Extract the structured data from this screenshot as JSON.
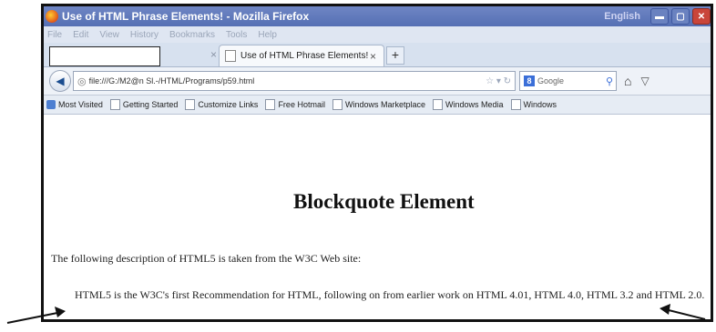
{
  "window": {
    "title": "Use of HTML Phrase Elements! - Mozilla Firefox",
    "language_indicator": "English"
  },
  "menu": [
    "File",
    "Edit",
    "View",
    "History",
    "Bookmarks",
    "Tools",
    "Help"
  ],
  "tabs": {
    "blank_tab_value": "",
    "active_label": "Use of HTML Phrase Elements!",
    "close_glyph": "×",
    "new_tab_glyph": "+"
  },
  "nav": {
    "url": "file:///G:/M2@n Sl.-/HTML/Programs/p59.html",
    "search_placeholder": "Google"
  },
  "bookmarks": [
    {
      "label": "Most Visited",
      "icon": "most-visited-icon"
    },
    {
      "label": "Getting Started",
      "icon": "page-icon"
    },
    {
      "label": "Customize Links",
      "icon": "page-icon"
    },
    {
      "label": "Free Hotmail",
      "icon": "page-icon"
    },
    {
      "label": "Windows Marketplace",
      "icon": "page-icon"
    },
    {
      "label": "Windows Media",
      "icon": "page-icon"
    },
    {
      "label": "Windows",
      "icon": "page-icon"
    }
  ],
  "page": {
    "heading": "Blockquote Element",
    "intro": "The following description of HTML5 is taken from the W3C Web site:",
    "blockquote": "HTML5 is the W3C's first Recommendation for HTML, following on from earlier work on HTML 4.01, HTML 4.0, HTML 3.2 and HTML 2.0."
  }
}
